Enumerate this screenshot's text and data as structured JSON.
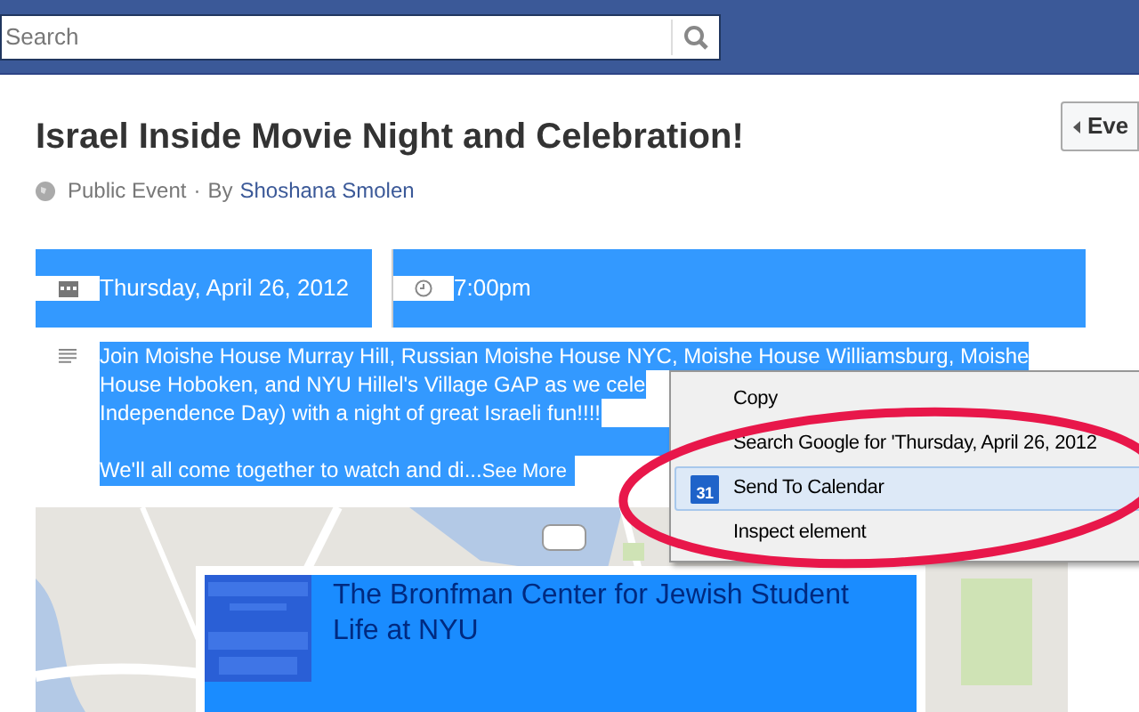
{
  "top_bar": {
    "search": {
      "placeholder": "Search"
    }
  },
  "side_button": {
    "label": "Eve"
  },
  "event": {
    "title": "Israel Inside Movie Night and Celebration!",
    "privacy": "Public Event",
    "separator": "·",
    "by": "By",
    "host": "Shoshana Smolen",
    "selected": true,
    "date": "Thursday, April 26, 2012",
    "time": "7:00pm",
    "description": [
      "Join Moishe House Murray Hill, Russian Moishe House NYC, Moishe House Williamsburg, Moishe",
      "House Hoboken, and NYU Hillel's Village GAP as we cele",
      "Independence Day) with a night of great Israeli fun!!!!"
    ],
    "teaser": "We'll all come together to watch and di...",
    "see_more": "See More"
  },
  "venue": {
    "name": "The Bronfman Center for Jewish Student",
    "name_2": "Life at NYU",
    "selected": true
  },
  "context_menu": {
    "items": [
      {
        "label": "Copy",
        "kind": "plain",
        "selected": false
      },
      {
        "label": "Search Google for 'Thursday, April 26, 2012",
        "kind": "plain",
        "selected": false
      },
      {
        "label": "Send To Calendar",
        "kind": "calendar",
        "icon_text": "31",
        "selected": true
      },
      {
        "label": "Inspect element",
        "kind": "plain",
        "selected": false
      }
    ]
  },
  "annotation": {
    "kind": "ellipse",
    "color": "#e8174a"
  }
}
